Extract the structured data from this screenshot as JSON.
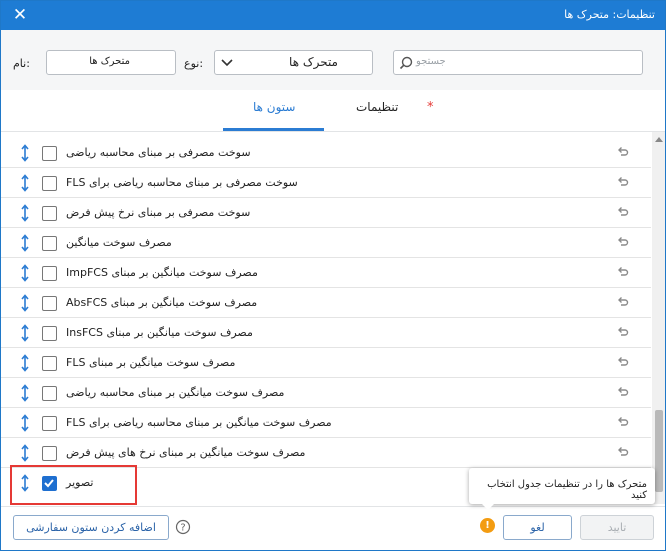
{
  "window": {
    "title": "تنظیمات: متحرک ها",
    "close_icon": "close-icon"
  },
  "search": {
    "placeholder": "جستجو"
  },
  "type_filter": {
    "label": "نوع:",
    "value": "متحرک ها"
  },
  "name_filter": {
    "label": "نام:",
    "value": "متحرک ها"
  },
  "tabs": {
    "settings": "تنظیمات",
    "columns": "ستون ها",
    "required_marker": "*"
  },
  "rows": [
    {
      "label": "سوخت مصرفی بر مبنای محاسبه ریاضی",
      "checked": false
    },
    {
      "label": "FLS سوخت مصرفی بر مبنای محاسبه ریاضی برای",
      "checked": false
    },
    {
      "label": "سوخت مصرفی بر مبنای نرخ پیش فرض",
      "checked": false
    },
    {
      "label": "مصرف سوخت میانگین",
      "checked": false
    },
    {
      "label": "ImpFCS مصرف سوخت میانگین بر مبنای",
      "checked": false
    },
    {
      "label": "AbsFCS مصرف سوخت میانگین بر مبنای",
      "checked": false
    },
    {
      "label": "InsFCS مصرف سوخت میانگین بر مبنای",
      "checked": false
    },
    {
      "label": "FLS مصرف سوخت میانگین بر مبنای",
      "checked": false
    },
    {
      "label": "مصرف سوخت میانگین بر مبنای محاسبه ریاضی",
      "checked": false
    },
    {
      "label": "FLS مصرف سوخت میانگین بر مبنای محاسبه ریاضی برای",
      "checked": false
    },
    {
      "label": "مصرف سوخت میانگین بر مبنای نرخ های پیش فرض",
      "checked": false
    },
    {
      "label": "تصویر",
      "checked": true
    }
  ],
  "footer": {
    "add_column": "اضافه کردن ستون سفارشی",
    "cancel": "لغو",
    "ok": "تایید",
    "warning_glyph": "!"
  },
  "tooltip": {
    "text": "متحرک ها را در تنظیمات جدول انتخاب کنید"
  },
  "colors": {
    "titlebar": "#1e7cd4",
    "accent": "#2b7cd3",
    "highlight": "#e53935",
    "warning": "#f39c12"
  }
}
